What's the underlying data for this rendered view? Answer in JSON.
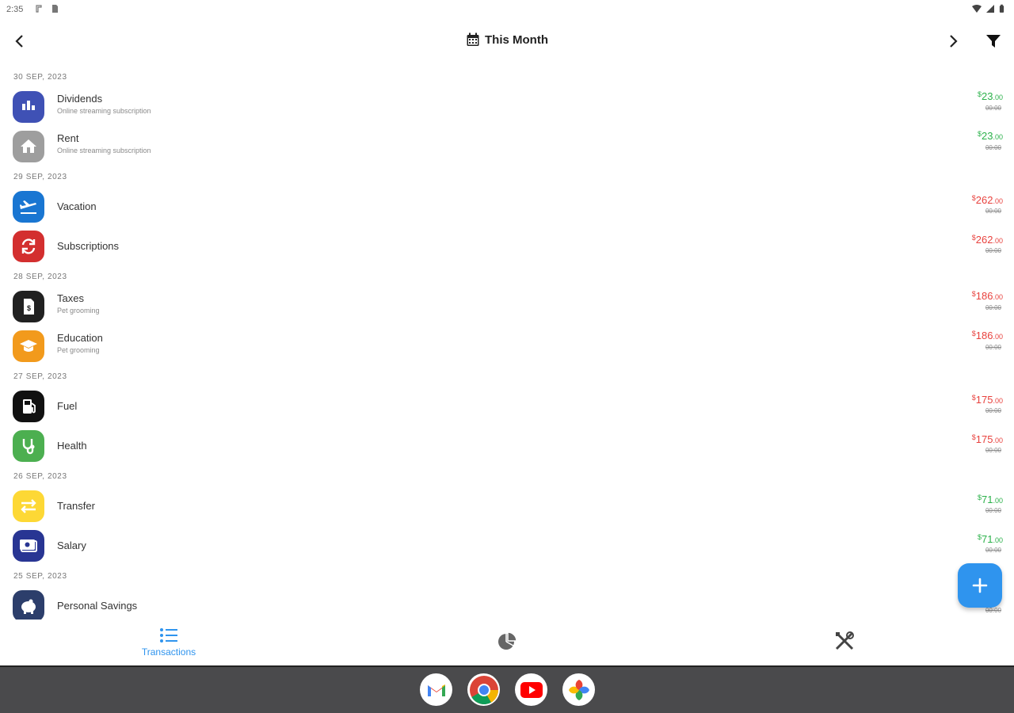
{
  "status_bar": {
    "time": "2:35"
  },
  "app_bar": {
    "title": "This Month"
  },
  "colors": {
    "income": "#2bb14a",
    "expense": "#e8423e",
    "accent": "#2f94ee"
  },
  "groups": [
    {
      "date": "30 SEP, 2023",
      "items": [
        {
          "name": "Dividends",
          "note": "Online streaming subscription",
          "currency": "$",
          "amount": "23",
          "cents": ".00",
          "time": "00:00",
          "type": "income",
          "icon": "stock-icon",
          "color": "#3f51b5"
        },
        {
          "name": "Rent",
          "note": "Online streaming subscription",
          "currency": "$",
          "amount": "23",
          "cents": ".00",
          "time": "00:00",
          "type": "income",
          "icon": "house-icon",
          "color": "#9e9e9e"
        }
      ]
    },
    {
      "date": "29 SEP, 2023",
      "items": [
        {
          "name": "Vacation",
          "note": "",
          "currency": "$",
          "amount": "262",
          "cents": ".00",
          "time": "00:00",
          "type": "expense",
          "icon": "plane-icon",
          "color": "#1976d2"
        },
        {
          "name": "Subscriptions",
          "note": "",
          "currency": "$",
          "amount": "262",
          "cents": ".00",
          "time": "00:00",
          "type": "expense",
          "icon": "repeat-icon",
          "color": "#d32f2f"
        }
      ]
    },
    {
      "date": "28 SEP, 2023",
      "items": [
        {
          "name": "Taxes",
          "note": "Pet grooming",
          "currency": "$",
          "amount": "186",
          "cents": ".00",
          "time": "00:00",
          "type": "expense",
          "icon": "tax-icon",
          "color": "#212121"
        },
        {
          "name": "Education",
          "note": "Pet grooming",
          "currency": "$",
          "amount": "186",
          "cents": ".00",
          "time": "00:00",
          "type": "expense",
          "icon": "graduation-cap-icon",
          "color": "#f29a1c"
        }
      ]
    },
    {
      "date": "27 SEP, 2023",
      "items": [
        {
          "name": "Fuel",
          "note": "",
          "currency": "$",
          "amount": "175",
          "cents": ".00",
          "time": "00:00",
          "type": "expense",
          "icon": "fuel-pump-icon",
          "color": "#111111"
        },
        {
          "name": "Health",
          "note": "",
          "currency": "$",
          "amount": "175",
          "cents": ".00",
          "time": "00:00",
          "type": "expense",
          "icon": "stethoscope-icon",
          "color": "#4caf50"
        }
      ]
    },
    {
      "date": "26 SEP, 2023",
      "items": [
        {
          "name": "Transfer",
          "note": "",
          "currency": "$",
          "amount": "71",
          "cents": ".00",
          "time": "00:00",
          "type": "income",
          "icon": "transfer-icon",
          "color": "#fdd835"
        },
        {
          "name": "Salary",
          "note": "",
          "currency": "$",
          "amount": "71",
          "cents": ".00",
          "time": "00:00",
          "type": "income",
          "icon": "cash-icon",
          "color": "#283593"
        }
      ]
    },
    {
      "date": "25 SEP, 2023",
      "items": [
        {
          "name": "Personal Savings",
          "note": "",
          "currency": "",
          "amount": "",
          "cents": "",
          "time": "00:00",
          "type": "income",
          "icon": "piggy-bank-icon",
          "color": "#2c3e6b"
        }
      ]
    }
  ],
  "bottom_nav": [
    {
      "label": "Transactions",
      "icon": "list-icon",
      "active": true
    },
    {
      "label": "",
      "icon": "pie-chart-icon",
      "active": false
    },
    {
      "label": "",
      "icon": "tools-icon",
      "active": false
    }
  ],
  "dock": [
    {
      "icon": "gmail-icon"
    },
    {
      "icon": "chrome-icon"
    },
    {
      "icon": "youtube-icon"
    },
    {
      "icon": "photos-icon"
    }
  ]
}
